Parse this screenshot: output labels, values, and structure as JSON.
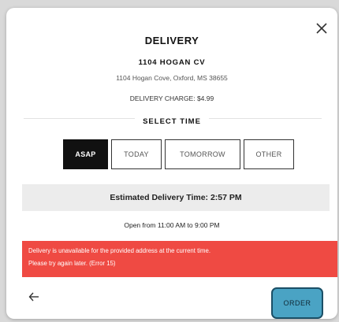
{
  "modal": {
    "title": "DELIVERY",
    "address_name": "1104 HOGAN CV",
    "address_line": "1104 Hogan Cove, Oxford, MS 38655",
    "delivery_charge": "DELIVERY CHARGE: $4.99",
    "select_time_label": "SELECT TIME",
    "time_options": [
      {
        "label": "ASAP",
        "selected": true
      },
      {
        "label": "TODAY",
        "selected": false
      },
      {
        "label": "TOMORROW",
        "selected": false
      },
      {
        "label": "OTHER",
        "selected": false
      }
    ],
    "estimated_time": "Estimated Delivery Time: 2:57 PM",
    "open_hours": "Open from 11:00 AM to 9:00 PM",
    "error_line1": "Delivery is unavailable for the provided address at the current time.",
    "error_line2": "Please try again later. (Error 15)",
    "order_label": "ORDER"
  },
  "icons": {
    "close": "close-icon",
    "back": "arrow-left-icon"
  },
  "colors": {
    "error_bg": "#ef4a43",
    "order_bg": "#4aa3c4",
    "selected_bg": "#111111"
  }
}
